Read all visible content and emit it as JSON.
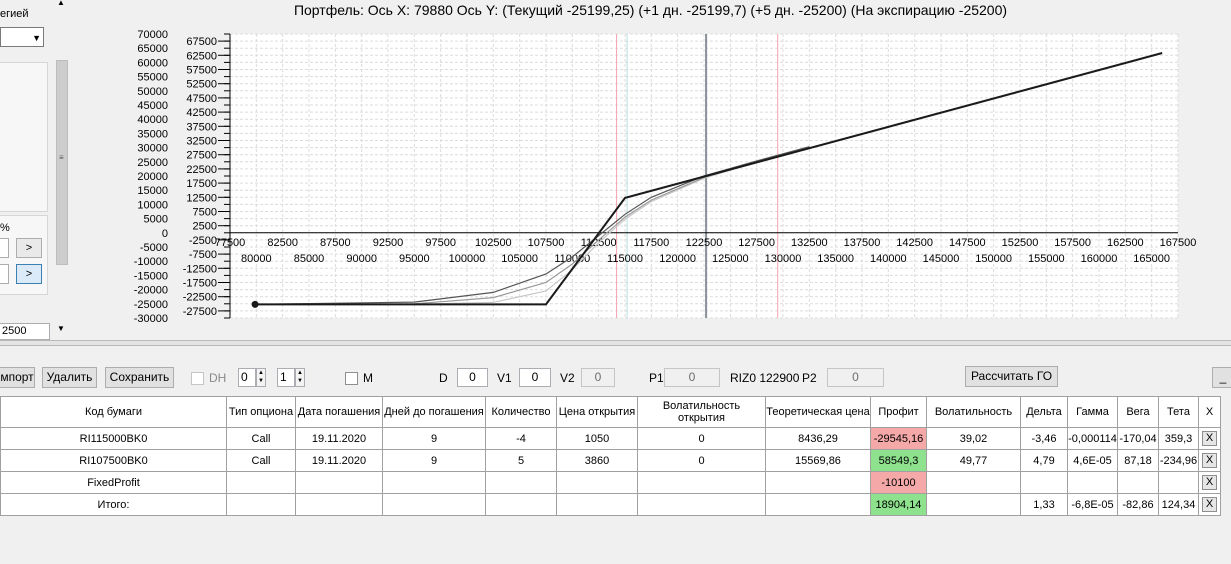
{
  "left_panel": {
    "strategy_label": "егией",
    "percent_label": "%",
    "arrow_button_1": ">",
    "arrow_button_2": ">",
    "value_field": "2500"
  },
  "chart": {
    "status_line": "Портфель: Ось X: 79880 Ось Y:  (Текущий -25199,25)  (+1 дн. -25199,7)  (+5 дн. -25200)  (На экспирацию -25200)",
    "y_ticks_outer": [
      "70000",
      "65000",
      "60000",
      "55000",
      "50000",
      "45000",
      "40000",
      "35000",
      "30000",
      "25000",
      "20000",
      "15000",
      "10000",
      "5000",
      "0",
      "-5000",
      "-10000",
      "-15000",
      "-20000",
      "-25000",
      "-30000"
    ],
    "y_ticks_inner": [
      "67500",
      "62500",
      "57500",
      "52500",
      "47500",
      "42500",
      "37500",
      "32500",
      "27500",
      "22500",
      "17500",
      "12500",
      "7500",
      "2500",
      "-2500",
      "-7500",
      "-12500",
      "-17500",
      "-22500",
      "-27500"
    ],
    "x_ticks_upper": [
      "77500",
      "82500",
      "87500",
      "92500",
      "97500",
      "102500",
      "107500",
      "112500",
      "117500",
      "122500",
      "127500",
      "132500",
      "137500",
      "142500",
      "147500",
      "152500",
      "157500",
      "162500",
      "167500"
    ],
    "x_ticks_lower": [
      "80000",
      "85000",
      "90000",
      "95000",
      "100000",
      "105000",
      "110000",
      "115000",
      "120000",
      "125000",
      "130000",
      "135000",
      "140000",
      "145000",
      "150000",
      "155000",
      "160000",
      "165000"
    ]
  },
  "chart_data": {
    "type": "line",
    "title": "",
    "xlabel": "",
    "ylabel": "",
    "xlim": [
      77500,
      167500
    ],
    "ylim": [
      -30000,
      70000
    ],
    "series": [
      {
        "name": "",
        "x": [
          79880,
          107500,
          115000,
          166000
        ],
        "y": [
          -25200,
          -25200,
          12300,
          63300
        ],
        "color": "#1a1a1a"
      },
      {
        "x": [
          79880,
          95000,
          102500,
          107500,
          110000,
          112500,
          115000,
          117500,
          122500,
          127500,
          132500
        ],
        "y": [
          -25200,
          -24400,
          -21000,
          -14500,
          -8500,
          -1000,
          6500,
          12500,
          20000,
          25300,
          30300
        ],
        "color": "#555555"
      },
      {
        "x": [
          79880,
          95000,
          102500,
          107500,
          110000,
          112500,
          115000,
          117500,
          122500,
          127500,
          132500
        ],
        "y": [
          -25200,
          -25000,
          -22800,
          -17500,
          -11000,
          -2500,
          5500,
          11500,
          19500,
          25100,
          30200
        ],
        "color": "#9a9a9a"
      },
      {
        "x": [
          79880,
          95000,
          102500,
          107500,
          110000,
          112500,
          115000,
          117500,
          122500,
          127500,
          132500
        ],
        "y": [
          -25200,
          -25200,
          -24500,
          -20500,
          -13000,
          -3500,
          4800,
          11000,
          19200,
          25000,
          30100
        ],
        "color": "#c8c8c8"
      }
    ],
    "markers": [
      {
        "x": 79880,
        "y": -25200
      }
    ],
    "vertical_lines": [
      {
        "x": 114200,
        "color": "#f4a3b3"
      },
      {
        "x": 115200,
        "color": "#b8e0e0"
      },
      {
        "x": 122700,
        "color": "#8a8f9a"
      },
      {
        "x": 129500,
        "color": "#f4a3b3"
      }
    ],
    "grid": true
  },
  "toolbar": {
    "import_label": "мпорт",
    "delete_label": "Удалить",
    "save_label": "Сохранить",
    "dh_label": "DH",
    "spin1_value": "0",
    "spin2_value": "1",
    "m_label": "M",
    "d_label": "D",
    "d_value": "0",
    "v1_label": "V1",
    "v1_value": "0",
    "v2_label": "V2",
    "v2_value": "0",
    "p1_label": "P1",
    "p1_value": "0",
    "riz_label": "RIZ0 122900",
    "p2_label": "P2",
    "p2_value": "0",
    "calc_label": "Рассчитать ГО",
    "min_label": "_"
  },
  "table": {
    "headers": [
      "Код бумаги",
      "Тип опциона",
      "Дата погашения",
      "Дней до погашения",
      "Количество",
      "Цена открытия",
      "Волатильность открытия",
      "Теоретическая цена",
      "Профит",
      "Волатильность",
      "Дельта",
      "Гамма",
      "Вега",
      "Тета",
      "X"
    ],
    "rows": [
      [
        "RI115000BK0",
        "Call",
        "19.11.2020",
        "9",
        "-4",
        "1050",
        "0",
        "8436,29",
        "-29545,16",
        "39,02",
        "-3,46",
        "-0,000114",
        "-170,04",
        "359,3",
        "X"
      ],
      [
        "RI107500BK0",
        "Call",
        "19.11.2020",
        "9",
        "5",
        "3860",
        "0",
        "15569,86",
        "58549,3",
        "49,77",
        "4,79",
        "4,6E-05",
        "87,18",
        "-234,96",
        "X"
      ],
      [
        "FixedProfit",
        "",
        "",
        "",
        "",
        "",
        "",
        "",
        "-10100",
        "",
        "",
        "",
        "",
        "",
        "X"
      ],
      [
        "Итого:",
        "",
        "",
        "",
        "",
        "",
        "",
        "",
        "18904,14",
        "",
        "1,33",
        "-6,8E-05",
        "-82,86",
        "124,34",
        "X"
      ]
    ],
    "profit_colors": [
      "#f5a8a8",
      "#8ee28e",
      "#f5a8a8",
      "#8ee28e"
    ]
  }
}
